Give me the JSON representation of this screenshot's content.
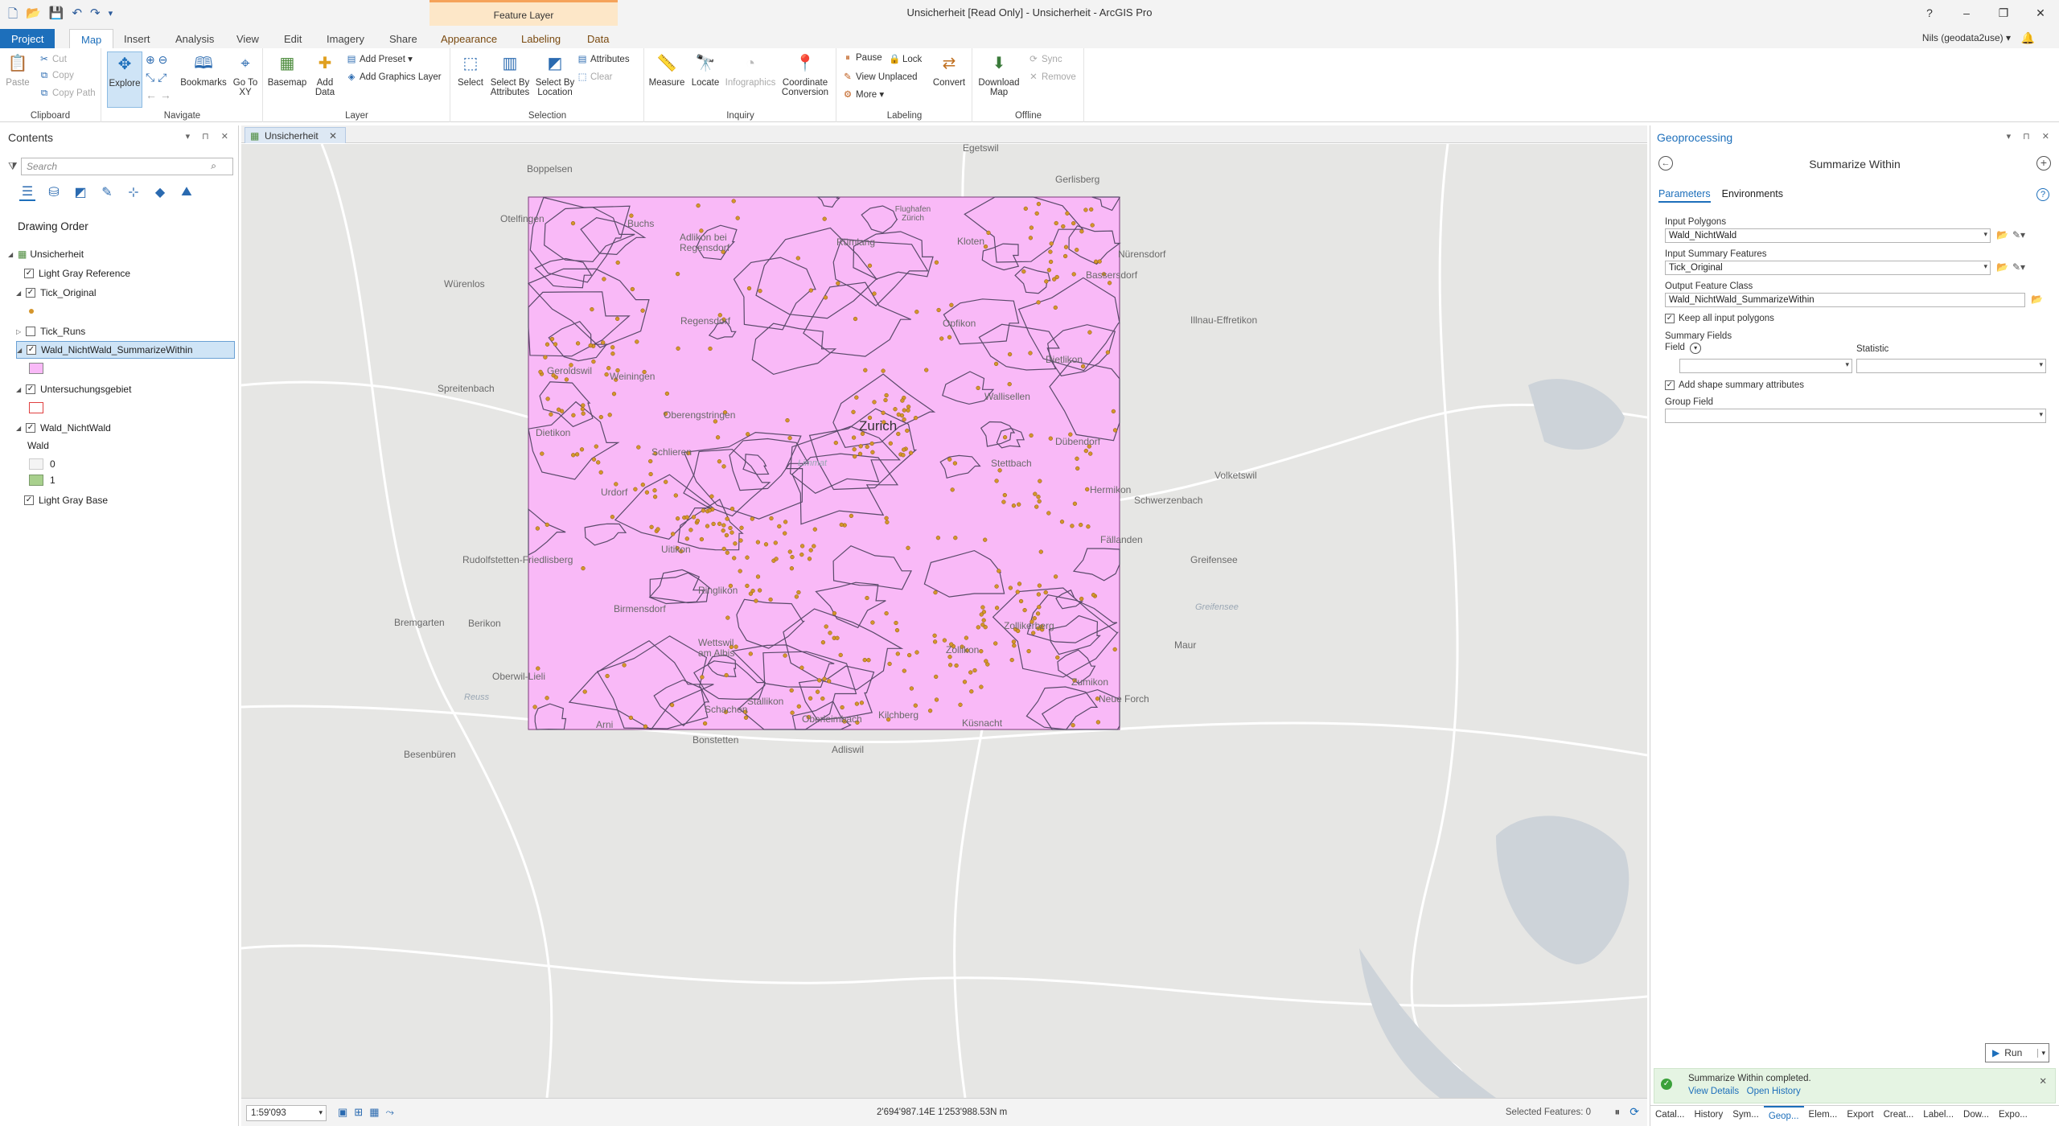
{
  "window": {
    "title": "Unsicherheit [Read Only] - Unsicherheit - ArcGIS Pro",
    "context_tab_group": "Feature Layer",
    "help": "?",
    "minimize": "–",
    "restore": "❐",
    "close": "✕"
  },
  "ribbon_tabs": [
    "Project",
    "Map",
    "Insert",
    "Analysis",
    "View",
    "Edit",
    "Imagery",
    "Share",
    "Appearance",
    "Labeling",
    "Data"
  ],
  "user": "Nils (geodata2use) ▾",
  "ribbon": {
    "clipboard": {
      "label": "Clipboard",
      "paste": "Paste",
      "cut": "Cut",
      "copy": "Copy",
      "copy_path": "Copy Path"
    },
    "navigate": {
      "label": "Navigate",
      "explore": "Explore",
      "bookmarks": "Bookmarks",
      "go_to_xy": "Go To XY"
    },
    "layer": {
      "label": "Layer",
      "basemap": "Basemap",
      "add_data": "Add Data",
      "add_preset": "Add Preset ▾",
      "add_graphics": "Add Graphics Layer"
    },
    "selection": {
      "label": "Selection",
      "select": "Select",
      "by_attributes": "Select By Attributes",
      "by_location": "Select By Location",
      "attributes": "Attributes",
      "clear": "Clear"
    },
    "inquiry": {
      "label": "Inquiry",
      "measure": "Measure",
      "locate": "Locate",
      "infographics": "Infographics",
      "coord_conv": "Coordinate Conversion"
    },
    "labeling": {
      "label": "Labeling",
      "pause": "Pause",
      "lock": "Lock",
      "view_unplaced": "View Unplaced",
      "more": "More ▾",
      "convert": "Convert"
    },
    "offline": {
      "label": "Offline",
      "download_map": "Download Map",
      "sync": "Sync",
      "remove": "Remove"
    }
  },
  "contents": {
    "title": "Contents",
    "search_placeholder": "Search",
    "drawing_order": "Drawing Order",
    "layers": [
      {
        "name": "Unsicherheit"
      },
      {
        "name": "Light Gray Reference"
      },
      {
        "name": "Tick_Original"
      },
      {
        "name": "Tick_Runs"
      },
      {
        "name": "Wald_NichtWald_SummarizeWithin"
      },
      {
        "name": "Untersuchungsgebiet"
      },
      {
        "name": "Wald_NichtWald"
      },
      {
        "name": "Wald"
      },
      {
        "name": "0"
      },
      {
        "name": "1"
      },
      {
        "name": "Light Gray Base"
      }
    ]
  },
  "map": {
    "tab": "Unsicherheit",
    "polygon_color": "#f9b9f7",
    "point_color": "#d4952b",
    "places": {
      "zurich": "Zurich",
      "egetswil": "Egetswil",
      "boppelsen": "Boppelsen",
      "gerlisberg": "Gerlisberg",
      "otelfingen": "Otelfingen",
      "buchs": "Buchs",
      "flughafen": "Flughafen Zürich",
      "adlikon": "Adlikon bei Regensdorf",
      "rumlang": "Rümlang",
      "kloten": "Kloten",
      "nurensdorf": "Nürensdorf",
      "bassersdorf": "Bassersdorf",
      "wurenlos": "Würenlos",
      "regensdorf": "Regensdorf",
      "opfikon": "Opfikon",
      "dietlikon": "Dietlikon",
      "illnau": "Illnau-Effretikon",
      "spreitenbach": "Spreitenbach",
      "geroldswil": "Geroldswil",
      "weiningen": "Weiningen",
      "wallisellen": "Wallisellen",
      "oberengstringen": "Oberengstringen",
      "dietikon": "Dietikon",
      "schlieren": "Schlieren",
      "dubendorf": "Dübendorf",
      "stettbach": "Stettbach",
      "limmat": "Limmat",
      "volketswil": "Volketswil",
      "urdorf": "Urdorf",
      "hermikon": "Hermikon",
      "schwerzenbach": "Schwerzenbach",
      "uitikon": "Uitikon",
      "fallanden": "Fällanden",
      "rudolfstetten": "Rudolfstetten-Friedlisberg",
      "greifensee": "Greifensee",
      "ringlikon": "Ringlikon",
      "greifensee_lake": "Greifensee",
      "birmensdorf": "Birmensdorf",
      "bremgarten": "Bremgarten",
      "berikon": "Berikon",
      "zollikerberg": "Zollikerberg",
      "wettswil": "Wettswil am Albis",
      "zollikon": "Zollikon",
      "maur": "Maur",
      "oberwil": "Oberwil-Lieli",
      "reuss": "Reuss",
      "zumikon": "Zumikon",
      "neue_forch": "Neue Forch",
      "stallikon": "Stallikon",
      "sellenburen": "Schachen",
      "arni": "Arni",
      "kilchberg": "Kilchberg",
      "oberleimbach": "Oberleimbach",
      "kusnacht": "Küsnacht",
      "besenburen": "Besenbüren",
      "bonstetten": "Bonstetten",
      "adliswil": "Adliswil"
    }
  },
  "status": {
    "scale": "1:59'093",
    "coords": "2'694'987.14E 1'253'988.53N m",
    "selected": "Selected Features: 0"
  },
  "geoprocessing": {
    "title": "Geoprocessing",
    "tool": "Summarize Within",
    "tab_params": "Parameters",
    "tab_env": "Environments",
    "input_polygons_label": "Input Polygons",
    "input_polygons": "Wald_NichtWald",
    "input_summary_label": "Input Summary Features",
    "input_summary": "Tick_Original",
    "output_label": "Output Feature Class",
    "output": "Wald_NichtWald_SummarizeWithin",
    "keep_all": "Keep all input polygons",
    "summary_fields": "Summary Fields",
    "field": "Field",
    "statistic": "Statistic",
    "add_shape": "Add shape summary  attributes",
    "group_field": "Group Field",
    "run": "Run",
    "done_msg": "Summarize Within completed.",
    "view_details": "View Details",
    "open_history": "Open History",
    "bottom_tabs": [
      "Catal...",
      "History",
      "Sym...",
      "Geop...",
      "Elem...",
      "Export",
      "Creat...",
      "Label...",
      "Dow...",
      "Expo..."
    ]
  }
}
